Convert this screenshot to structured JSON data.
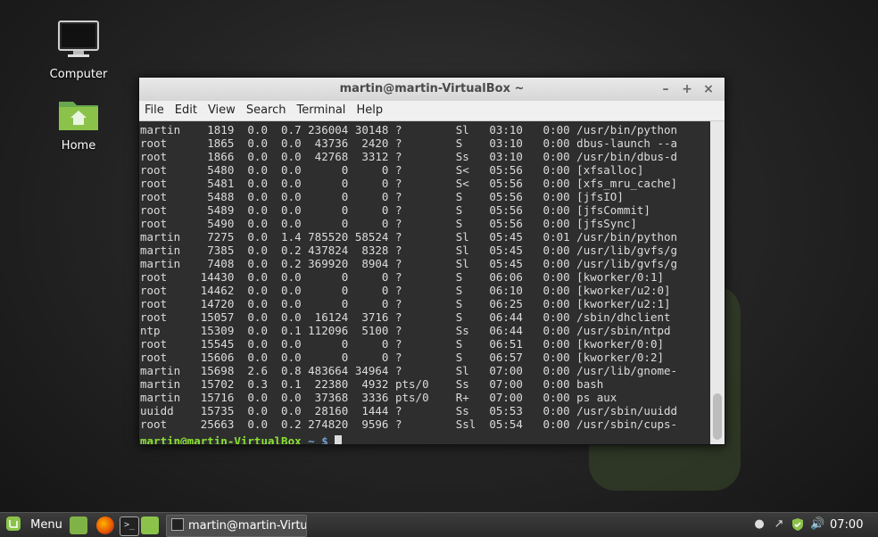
{
  "desktop": {
    "icons": [
      {
        "label": "Computer",
        "icon": "computer-icon"
      },
      {
        "label": "Home",
        "icon": "home-folder-icon"
      }
    ]
  },
  "window": {
    "title": "martin@martin-VirtualBox ~",
    "controls": {
      "minimize": "–",
      "maximize": "+",
      "close": "×"
    },
    "menu": [
      "File",
      "Edit",
      "View",
      "Search",
      "Terminal",
      "Help"
    ]
  },
  "terminal": {
    "lines": [
      "martin    1819  0.0  0.7 236004 30148 ?        Sl   03:10   0:00 /usr/bin/python",
      "root      1865  0.0  0.0  43736  2420 ?        S    03:10   0:00 dbus-launch --a",
      "root      1866  0.0  0.0  42768  3312 ?        Ss   03:10   0:00 /usr/bin/dbus-d",
      "root      5480  0.0  0.0      0     0 ?        S<   05:56   0:00 [xfsalloc]",
      "root      5481  0.0  0.0      0     0 ?        S<   05:56   0:00 [xfs_mru_cache]",
      "root      5488  0.0  0.0      0     0 ?        S    05:56   0:00 [jfsIO]",
      "root      5489  0.0  0.0      0     0 ?        S    05:56   0:00 [jfsCommit]",
      "root      5490  0.0  0.0      0     0 ?        S    05:56   0:00 [jfsSync]",
      "martin    7275  0.0  1.4 785520 58524 ?        Sl   05:45   0:01 /usr/bin/python",
      "martin    7385  0.0  0.2 437824  8328 ?        Sl   05:45   0:00 /usr/lib/gvfs/g",
      "martin    7408  0.0  0.2 369920  8904 ?        Sl   05:45   0:00 /usr/lib/gvfs/g",
      "root     14430  0.0  0.0      0     0 ?        S    06:06   0:00 [kworker/0:1]",
      "root     14462  0.0  0.0      0     0 ?        S    06:10   0:00 [kworker/u2:0]",
      "root     14720  0.0  0.0      0     0 ?        S    06:25   0:00 [kworker/u2:1]",
      "root     15057  0.0  0.0  16124  3716 ?        S    06:44   0:00 /sbin/dhclient",
      "ntp      15309  0.0  0.1 112096  5100 ?        Ss   06:44   0:00 /usr/sbin/ntpd",
      "root     15545  0.0  0.0      0     0 ?        S    06:51   0:00 [kworker/0:0]",
      "root     15606  0.0  0.0      0     0 ?        S    06:57   0:00 [kworker/0:2]",
      "martin   15698  2.6  0.8 483664 34964 ?        Sl   07:00   0:00 /usr/lib/gnome-",
      "martin   15702  0.3  0.1  22380  4932 pts/0    Ss   07:00   0:00 bash",
      "martin   15716  0.0  0.0  37368  3336 pts/0    R+   07:00   0:00 ps aux",
      "uuidd    15735  0.0  0.0  28160  1444 ?        Ss   05:53   0:00 /usr/sbin/uuidd",
      "root     25663  0.0  0.2 274820  9596 ?        Ssl  05:54   0:00 /usr/sbin/cups-"
    ],
    "prompt_user": "martin@martin-VirtualBox",
    "prompt_symbol": " ~ $"
  },
  "taskbar": {
    "menu_label": "Menu",
    "launchers": [
      "show-desktop-icon",
      "firefox-icon",
      "terminal-icon",
      "files-icon"
    ],
    "window_button": "martin@martin-Virtu…",
    "tray_icons": [
      "user-icon",
      "network-icon",
      "shield-update-icon",
      "volume-icon"
    ],
    "clock": "07:00"
  },
  "colors": {
    "terminal_bg": "#2e2e2e",
    "prompt_user": "#8ae234",
    "prompt_symbol": "#729fcf"
  }
}
